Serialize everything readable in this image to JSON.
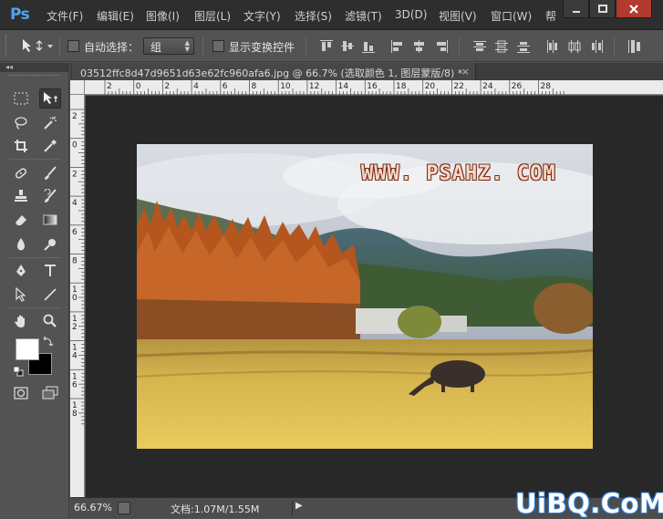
{
  "app": {
    "logo": "Ps"
  },
  "menu": [
    "文件(F)",
    "编辑(E)",
    "图像(I)",
    "图层(L)",
    "文字(Y)",
    "选择(S)",
    "滤镜(T)",
    "3D(D)",
    "视图(V)",
    "窗口(W)",
    "帮"
  ],
  "options": {
    "auto_select_label": "自动选择：",
    "auto_select_value": "组",
    "show_transform_label": "显示变换控件"
  },
  "toolpanel": {
    "header": "◂◂"
  },
  "document": {
    "tab_title": "03512ffc8d47d9651d63e62fc960afa6.jpg @ 66.7% (选取颜色 1, 图层蒙版/8) *",
    "tab_close": "×",
    "watermark": "WWW. PSAHZ. COM"
  },
  "ruler": {
    "h_ticks": [
      "2",
      "0",
      "2",
      "4",
      "6",
      "8",
      "10",
      "12",
      "14",
      "16",
      "18",
      "20",
      "22",
      "24",
      "26",
      "28"
    ],
    "v_ticks": [
      "2",
      "0",
      "2",
      "4",
      "6",
      "8",
      "1 0",
      "1 2",
      "1 4",
      "1 6",
      "1 8"
    ]
  },
  "status": {
    "zoom": "66.67%",
    "doc_info": "文档:1.07M/1.55M",
    "arrow": "▶"
  },
  "site_logo": "UiBQ.CoM",
  "colors": {
    "foreground": "#ffffff",
    "background": "#000000",
    "ps_blue": "#4fa3f0",
    "close_red": "#b23a2e"
  }
}
